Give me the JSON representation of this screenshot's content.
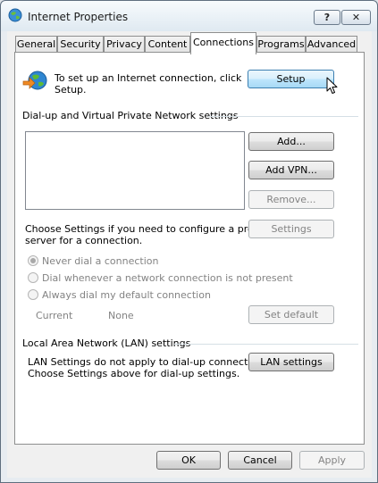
{
  "window": {
    "title": "Internet Properties",
    "help_glyph": "?",
    "close_glyph": "✕"
  },
  "tabs": [
    {
      "label": "General"
    },
    {
      "label": "Security"
    },
    {
      "label": "Privacy"
    },
    {
      "label": "Content"
    },
    {
      "label": "Connections",
      "active": true
    },
    {
      "label": "Programs"
    },
    {
      "label": "Advanced"
    }
  ],
  "setup": {
    "text_line1": "To set up an Internet connection, click",
    "text_line2": "Setup.",
    "button": "Setup"
  },
  "dialup": {
    "heading": "Dial-up and Virtual Private Network settings",
    "add_button": "Add...",
    "add_vpn_button": "Add VPN...",
    "remove_button": "Remove...",
    "proxy_text_line1": "Choose Settings if you need to configure a proxy",
    "proxy_text_line2": "server for a connection.",
    "settings_button": "Settings",
    "options": [
      {
        "label": "Never dial a connection",
        "checked": true
      },
      {
        "label": "Dial whenever a network connection is not present",
        "checked": false
      },
      {
        "label": "Always dial my default connection",
        "checked": false
      }
    ],
    "current_label": "Current",
    "current_value": "None",
    "set_default_button": "Set default"
  },
  "lan": {
    "heading": "Local Area Network (LAN) settings",
    "text_line1": "LAN Settings do not apply to dial-up connections.",
    "text_line2": "Choose Settings above for dial-up settings.",
    "button": "LAN settings"
  },
  "footer": {
    "ok": "OK",
    "cancel": "Cancel",
    "apply": "Apply"
  },
  "colors": {
    "hot_button": "#bee6fd",
    "disabled_text": "#838383"
  }
}
